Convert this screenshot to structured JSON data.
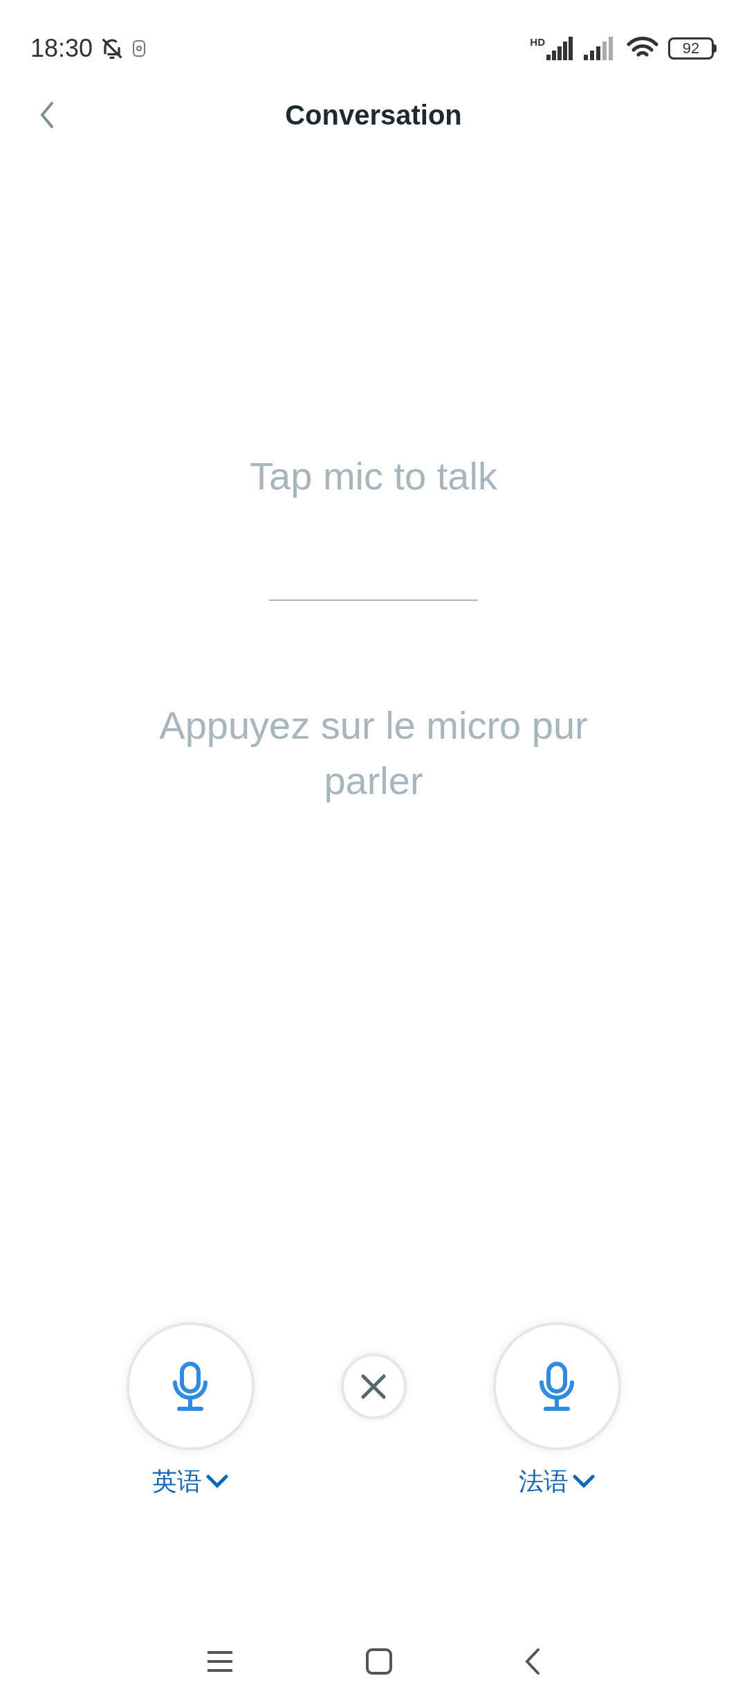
{
  "status_bar": {
    "time": "18:30",
    "network_label": "HD",
    "battery": "92"
  },
  "header": {
    "title": "Conversation"
  },
  "prompts": {
    "source": "Tap mic to talk",
    "target": "Appuyez sur le micro pur parler"
  },
  "languages": [
    {
      "label": "英语"
    },
    {
      "label": "法语"
    }
  ]
}
